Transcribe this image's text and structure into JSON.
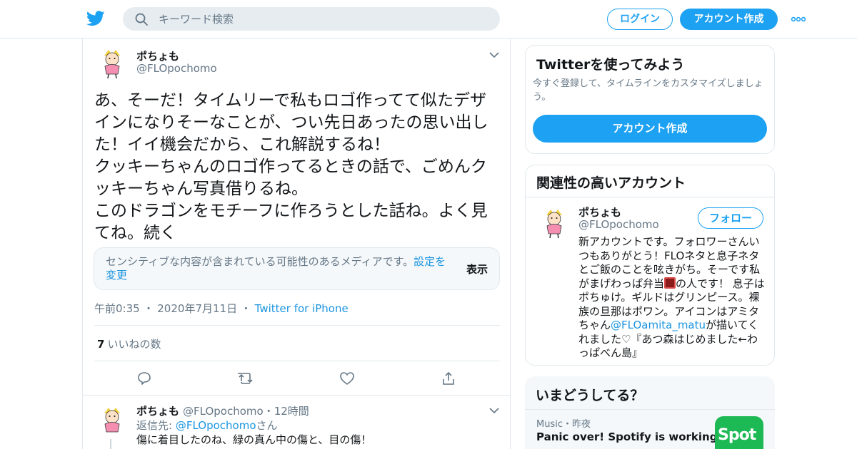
{
  "header": {
    "search_placeholder": "キーワード検索",
    "login_label": "ログイン",
    "signup_label": "アカウント作成"
  },
  "tweet": {
    "author_name": "ポちょも",
    "author_handle": "@FLOpochomo",
    "text": "あ、そーだ！タイムリーで私もロゴ作ってて似たデザインになりそーなことが、つい先日あったの思い出した！イイ機会だから、これ解説するね！\nクッキーちゃんのロゴ作ってるときの話で、ごめんクッキーちゃん写真借りるね。\nこのドラゴンをモチーフに作ろうとした話ね。よく見てね。続く",
    "sensitive_text": "センシティブな内容が含まれている可能性のあるメディアです。",
    "sensitive_link": "設定を変更",
    "sensitive_show": "表示",
    "time": "午前0:35",
    "date": "2020年7月11日",
    "source": "Twitter for iPhone",
    "like_count": "7",
    "like_label": "いいねの数"
  },
  "reply": {
    "author_name": "ポちょも",
    "author_handle": "@FLOpochomo",
    "time_ago": "12時間",
    "reply_to_label": "返信先:",
    "reply_to_handle": "@FLOpochomo",
    "reply_to_suffix": "さん",
    "text": "傷に着目したのね、緑の真ん中の傷と、目の傷！"
  },
  "signup_card": {
    "title": "Twitterを使ってみよう",
    "subtitle": "今すぐ登録して、タイムラインをカスタマイズしましょう。",
    "button": "アカウント作成"
  },
  "related_card": {
    "title": "関連性の高いアカウント",
    "name": "ポちょも",
    "handle": "@FLOpochomo",
    "follow_label": "フォロー",
    "bio_1": "新アカウントです。フォロワーさんいつもありがとう！FLOネタと息子ネタとご飯のことを呟きがち。そーです私がまげわっぱ弁当",
    "bio_2": "の人です！ 息子はポちゅけ。ギルドはグリンピース。裸族の旦那はポワン。アイコンはアミタちゃん",
    "bio_mention": "@FLOamita_matu",
    "bio_3": "が描いてくれました♡『あつ森はじめました←わっぱべん島』"
  },
  "trends": {
    "title": "いまどうしてる？",
    "category": "Music",
    "time": "昨夜",
    "headline": "Panic over! Spotify is working on",
    "thumb_text": "Spot"
  },
  "colors": {
    "accent": "#1da1f2",
    "link": "#1b95e0",
    "muted": "#657786",
    "border": "#e1e8ed"
  }
}
